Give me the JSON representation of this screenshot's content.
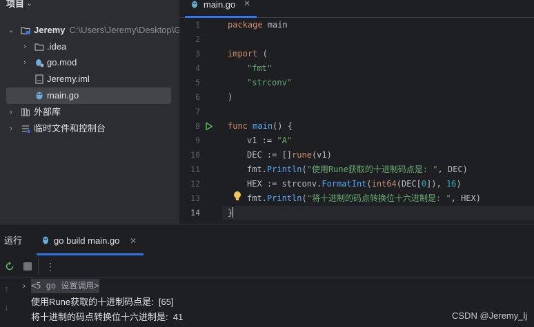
{
  "project_panel": {
    "title": "项目",
    "tree": [
      {
        "label": "Jeremy",
        "path": "C:\\Users\\Jeremy\\Desktop\\G",
        "expanded": true,
        "icon": "module-folder-icon"
      },
      {
        "label": ".idea",
        "icon": "folder-icon"
      },
      {
        "label": "go.mod",
        "icon": "gomod-icon"
      },
      {
        "label": "Jeremy.iml",
        "icon": "iml-file-icon"
      },
      {
        "label": "main.go",
        "icon": "go-file-icon",
        "selected": true
      },
      {
        "label": "外部库",
        "icon": "library-icon"
      },
      {
        "label": "临时文件和控制台",
        "icon": "scratches-icon"
      }
    ]
  },
  "editor": {
    "tab": {
      "label": "main.go"
    },
    "line_numbers": [
      "1",
      "2",
      "3",
      "4",
      "5",
      "6",
      "7",
      "8",
      "9",
      "10",
      "11",
      "12",
      "13",
      "14"
    ],
    "current_line": "14",
    "code": {
      "l1_kw": "package",
      "l1_rest": " main",
      "l3_kw": "import",
      "l3_rest": " (",
      "l4": "\"fmt\"",
      "l5": "\"strconv\"",
      "l6": ")",
      "l8_kw": "func",
      "l8_fn": "main",
      "l8_rest": "() {",
      "l9_a": "v1 := ",
      "l9_str": "\"A\"",
      "l10_a": "DEC := []",
      "l10_kw": "rune",
      "l10_b": "(v1)",
      "l11_a": "fmt.",
      "l11_fn": "Println",
      "l11_b": "(",
      "l11_str": "\"使用Rune获取的十进制码点是: \"",
      "l11_c": ", DEC)",
      "l12_a": "HEX := strconv.",
      "l12_fn": "FormatInt",
      "l12_b": "(",
      "l12_kw": "int64",
      "l12_c": "(DEC[",
      "l12_num1": "0",
      "l12_d": "]), ",
      "l12_num2": "16",
      "l12_e": ")",
      "l13_a": "fmt.",
      "l13_fn": "Println",
      "l13_b": "(",
      "l13_str": "\"将十进制的码点转换位十六进制是: \"",
      "l13_c": ", HEX)",
      "l14": "}"
    }
  },
  "run_panel": {
    "title": "运行",
    "tab": {
      "label": "go build main.go"
    },
    "output": {
      "header": "<5 go 设置调用>",
      "line1": "使用Rune获取的十进制码点是:  [65]",
      "line2": "将十进制的码点转换位十六进制是:  41"
    }
  },
  "watermark": "CSDN @Jeremy_lj",
  "colors": {
    "accent": "#3574f0",
    "run_green": "#5fb865",
    "keyword": "#cf8e6d",
    "string": "#6aab73",
    "function": "#56a8f5",
    "number": "#2aacb8"
  }
}
